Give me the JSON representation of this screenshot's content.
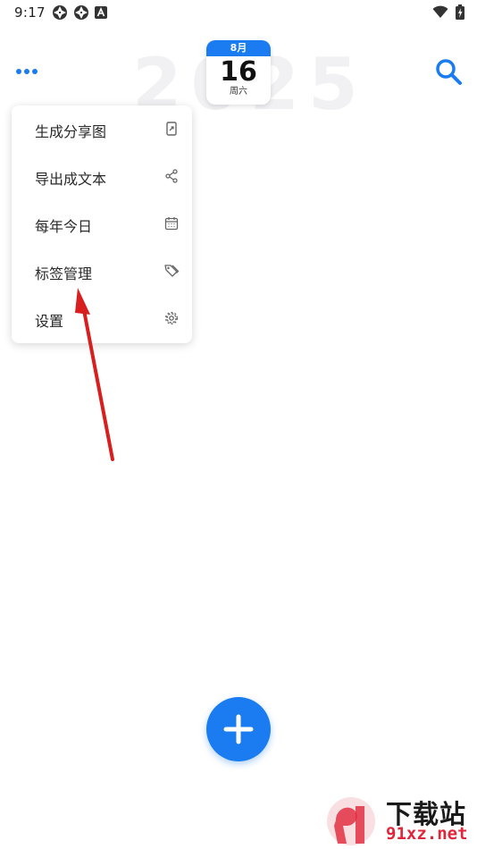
{
  "status_bar": {
    "time": "9:17",
    "left_icons": [
      "aperture-icon",
      "aperture-icon",
      "app-a-icon"
    ],
    "right_icons": [
      "wifi-icon",
      "battery-charging-icon"
    ]
  },
  "header": {
    "year_watermark": "2025",
    "date_card": {
      "month": "8月",
      "day": "16",
      "weekday": "周六"
    },
    "menu_icon": "more-dots-icon",
    "search_icon": "search-icon"
  },
  "dropdown": {
    "items": [
      {
        "label": "生成分享图",
        "icon": "share-image-icon"
      },
      {
        "label": "导出成文本",
        "icon": "share-icon"
      },
      {
        "label": "每年今日",
        "icon": "calendar-icon"
      },
      {
        "label": "标签管理",
        "icon": "tags-icon"
      },
      {
        "label": "设置",
        "icon": "gear-icon"
      }
    ]
  },
  "fab": {
    "icon": "plus-icon"
  },
  "watermark": {
    "title": "下载站",
    "url": "91xz.net"
  },
  "colors": {
    "accent": "#1a7cf0",
    "arrow": "#d81e1e",
    "watermark_red": "#e1253a"
  }
}
